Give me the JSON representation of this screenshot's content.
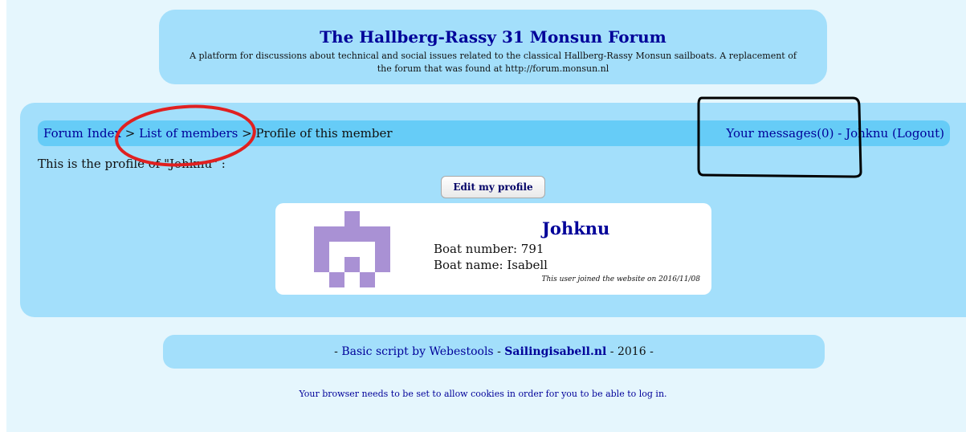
{
  "header": {
    "title": "The Hallberg-Rassy 31 Monsun Forum",
    "description": "A platform for discussions about technical and social issues related to the classical Hallberg-Rassy Monsun sailboats. A replacement of the forum that was found at http://forum.monsun.nl"
  },
  "breadcrumb": {
    "forum_index": "Forum Index",
    "sep1": " > ",
    "list_members": "List of members",
    "sep2": " > ",
    "current": "Profile of this member"
  },
  "user_nav": {
    "messages": "Your messages(0)",
    "dash": " - ",
    "username": "Johknu",
    "logout": "(Logout)"
  },
  "intro_text": "This is the profile of \"Johknu\" :",
  "edit_button": "Edit my profile",
  "profile": {
    "name": "Johknu",
    "boat_number": "Boat number: 791",
    "boat_name": "Boat name: Isabell",
    "joined": "This user joined the website on 2016/11/08",
    "avatar_color": "#a991d4"
  },
  "footer": {
    "prefix": "- ",
    "basic_script": "Basic script by Webestools",
    "mid": " - ",
    "site": "Sailingisabell.nl",
    "suffix": " - 2016 -"
  },
  "cookie_note": "Your browser needs to be set to allow cookies in order for you to be able to log in.",
  "annotations": {
    "red_ellipse_color": "#e02020",
    "black_box_color": "#000000"
  }
}
